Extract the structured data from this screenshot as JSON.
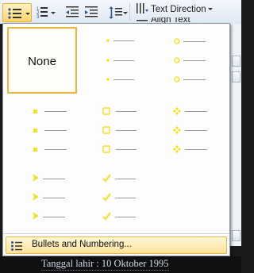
{
  "ribbon": {
    "text_direction_label": "Text Direction",
    "second_label": "Align Text"
  },
  "bullet_library": {
    "none_label": "None",
    "styles": [
      {
        "name": "none"
      },
      {
        "name": "small-dot"
      },
      {
        "name": "hollow-circle"
      },
      {
        "name": "filled-square"
      },
      {
        "name": "hollow-square"
      },
      {
        "name": "four-diamond"
      },
      {
        "name": "arrowhead"
      },
      {
        "name": "checkmark"
      }
    ],
    "bullet_color": "#f2e21a",
    "line_color": "#9a9a9a"
  },
  "menu": {
    "bullets_and_numbering_label": "Bullets and Numbering..."
  },
  "document": {
    "visible_text": "Tanggal lahir : 10 Oktober 1995"
  },
  "colors": {
    "hover_gold": "#e3b94b",
    "panel_border": "#8e9aa8"
  }
}
